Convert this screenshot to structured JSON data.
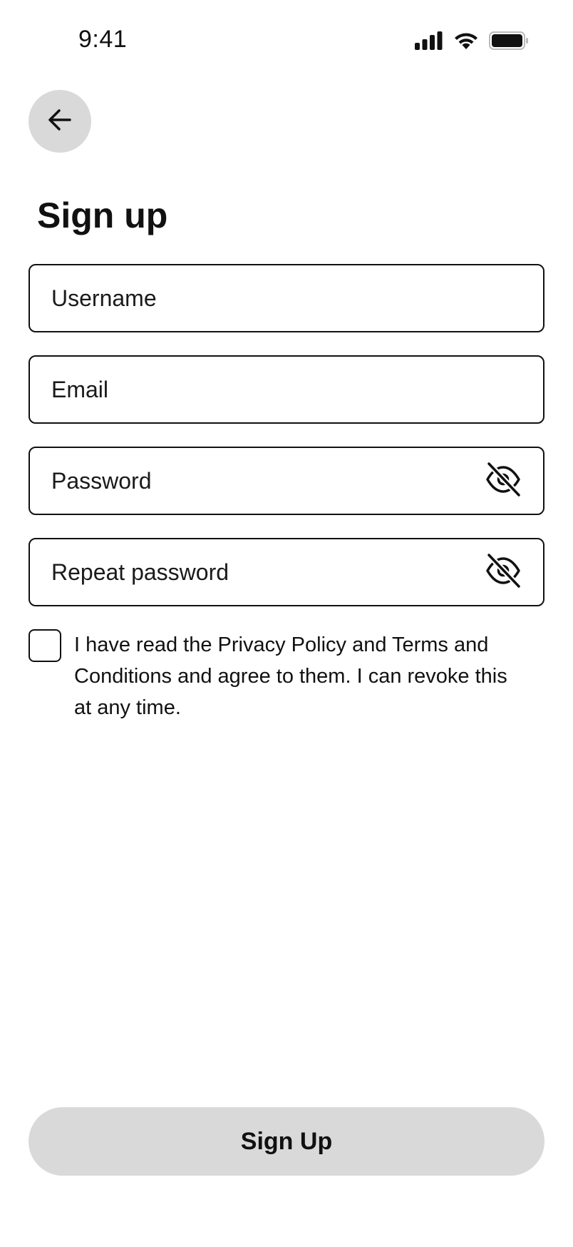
{
  "status_bar": {
    "time": "9:41",
    "icons": [
      "cellular-signal-icon",
      "wifi-icon",
      "battery-icon"
    ]
  },
  "header": {
    "back_icon": "arrow-left-icon"
  },
  "title": "Sign up",
  "form": {
    "username": {
      "value": "",
      "placeholder": "Username"
    },
    "email": {
      "value": "",
      "placeholder": "Email"
    },
    "password": {
      "value": "",
      "placeholder": "Password",
      "toggle_icon": "eye-off-icon"
    },
    "repeat_password": {
      "value": "",
      "placeholder": "Repeat password",
      "toggle_icon": "eye-off-icon"
    }
  },
  "consent": {
    "checked": false,
    "text": "I have read the Privacy Policy and Terms and Conditions and agree to them. I can revoke this at any time."
  },
  "submit": {
    "label": "Sign Up"
  },
  "colors": {
    "background": "#ffffff",
    "button_fill": "#d9d9d9",
    "text": "#111111",
    "border": "#111111"
  }
}
